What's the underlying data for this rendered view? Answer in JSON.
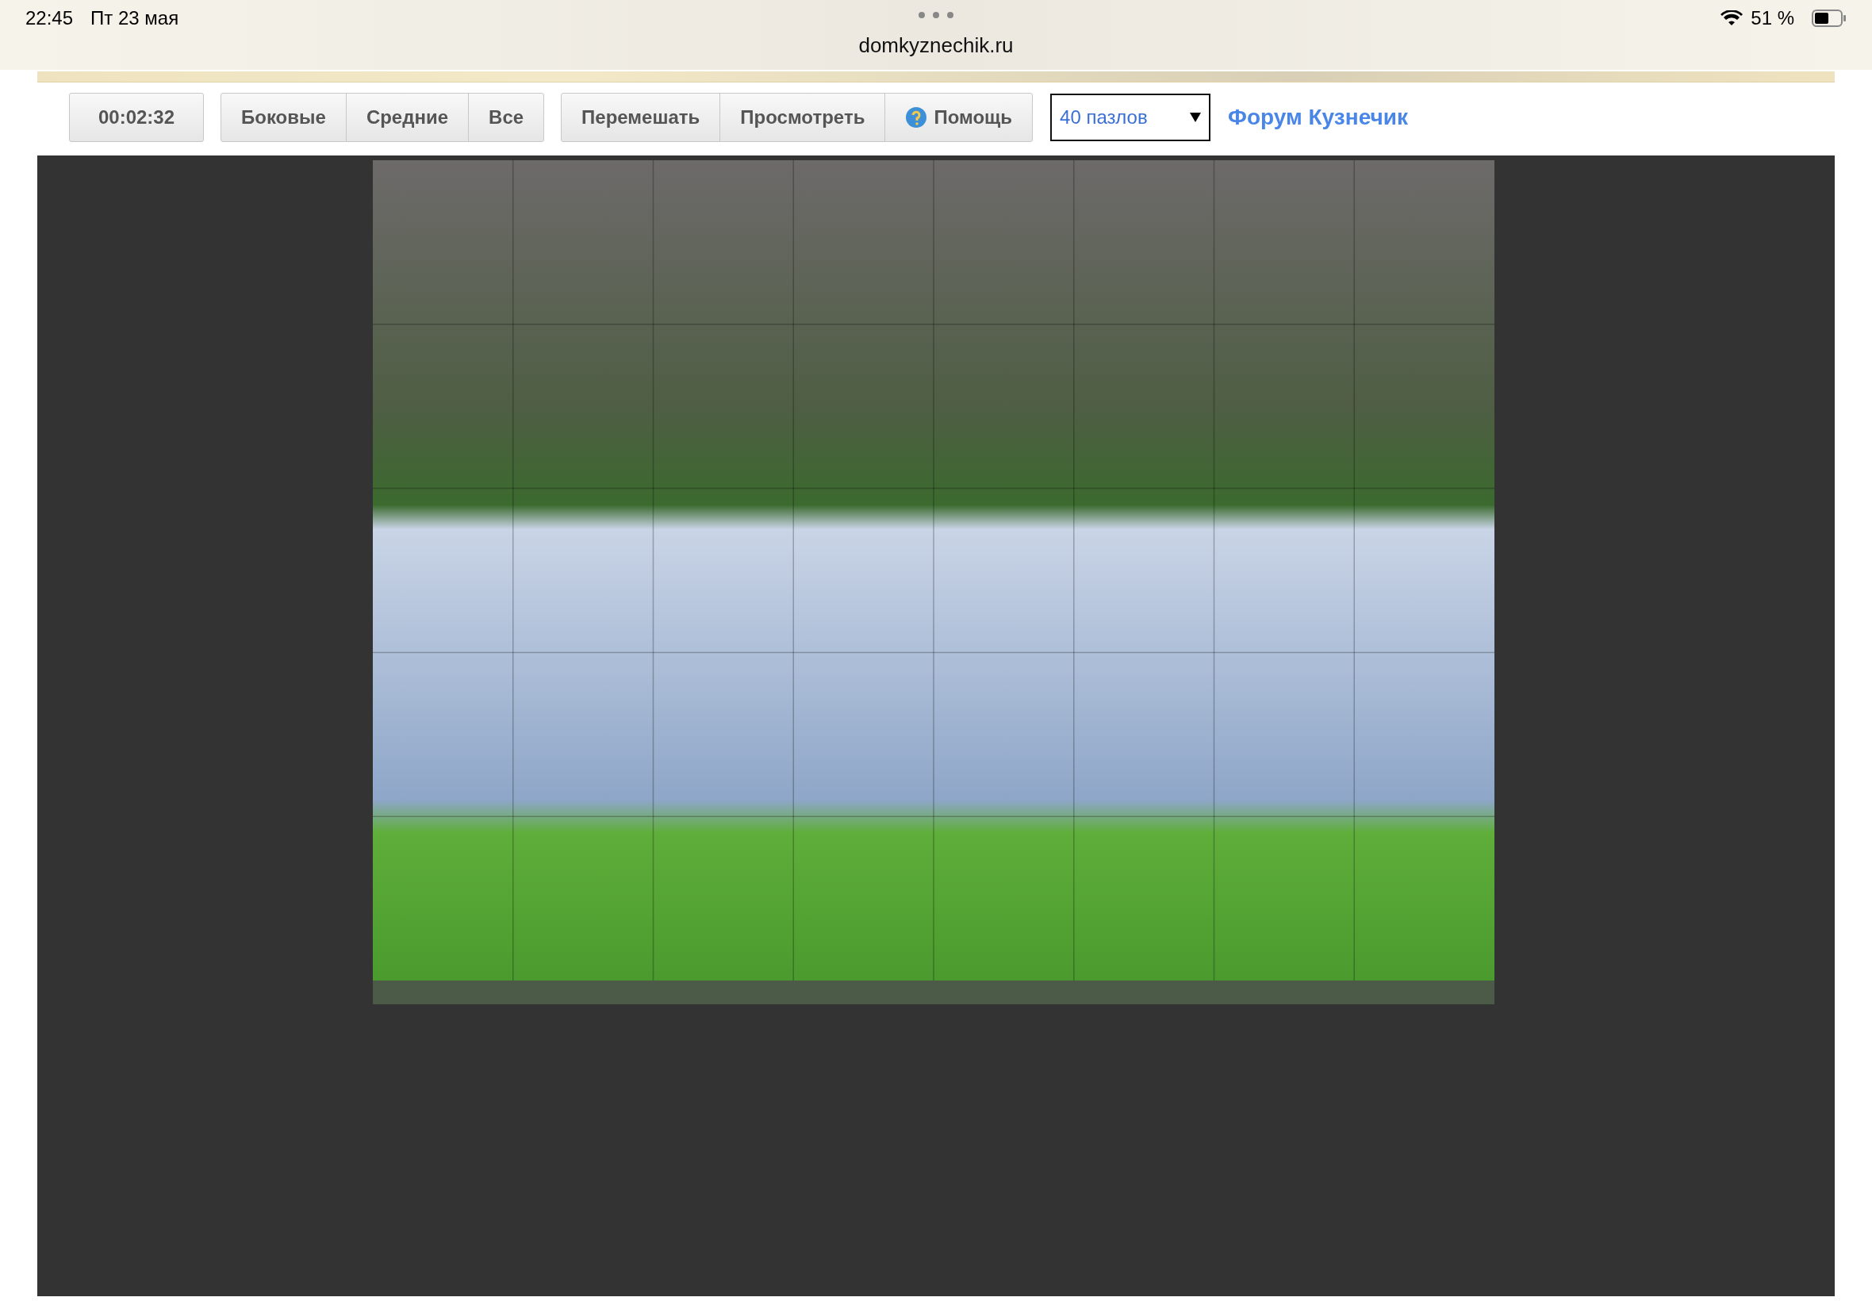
{
  "status_bar": {
    "time": "22:45",
    "date": "Пт 23 мая",
    "battery": "51 %"
  },
  "browser": {
    "address": "domkyznechik.ru"
  },
  "toolbar": {
    "timer": "00:02:32",
    "filter_buttons": [
      "Боковые",
      "Средние",
      "Все"
    ],
    "action_buttons": [
      {
        "label": "Перемешать",
        "kind": "plain"
      },
      {
        "label": "Просмотреть",
        "kind": "plain"
      },
      {
        "label": "Помощь",
        "kind": "help"
      }
    ],
    "pieces_select": {
      "value": "40 пазлов"
    },
    "forum_link": "Форум Кузнечик"
  }
}
